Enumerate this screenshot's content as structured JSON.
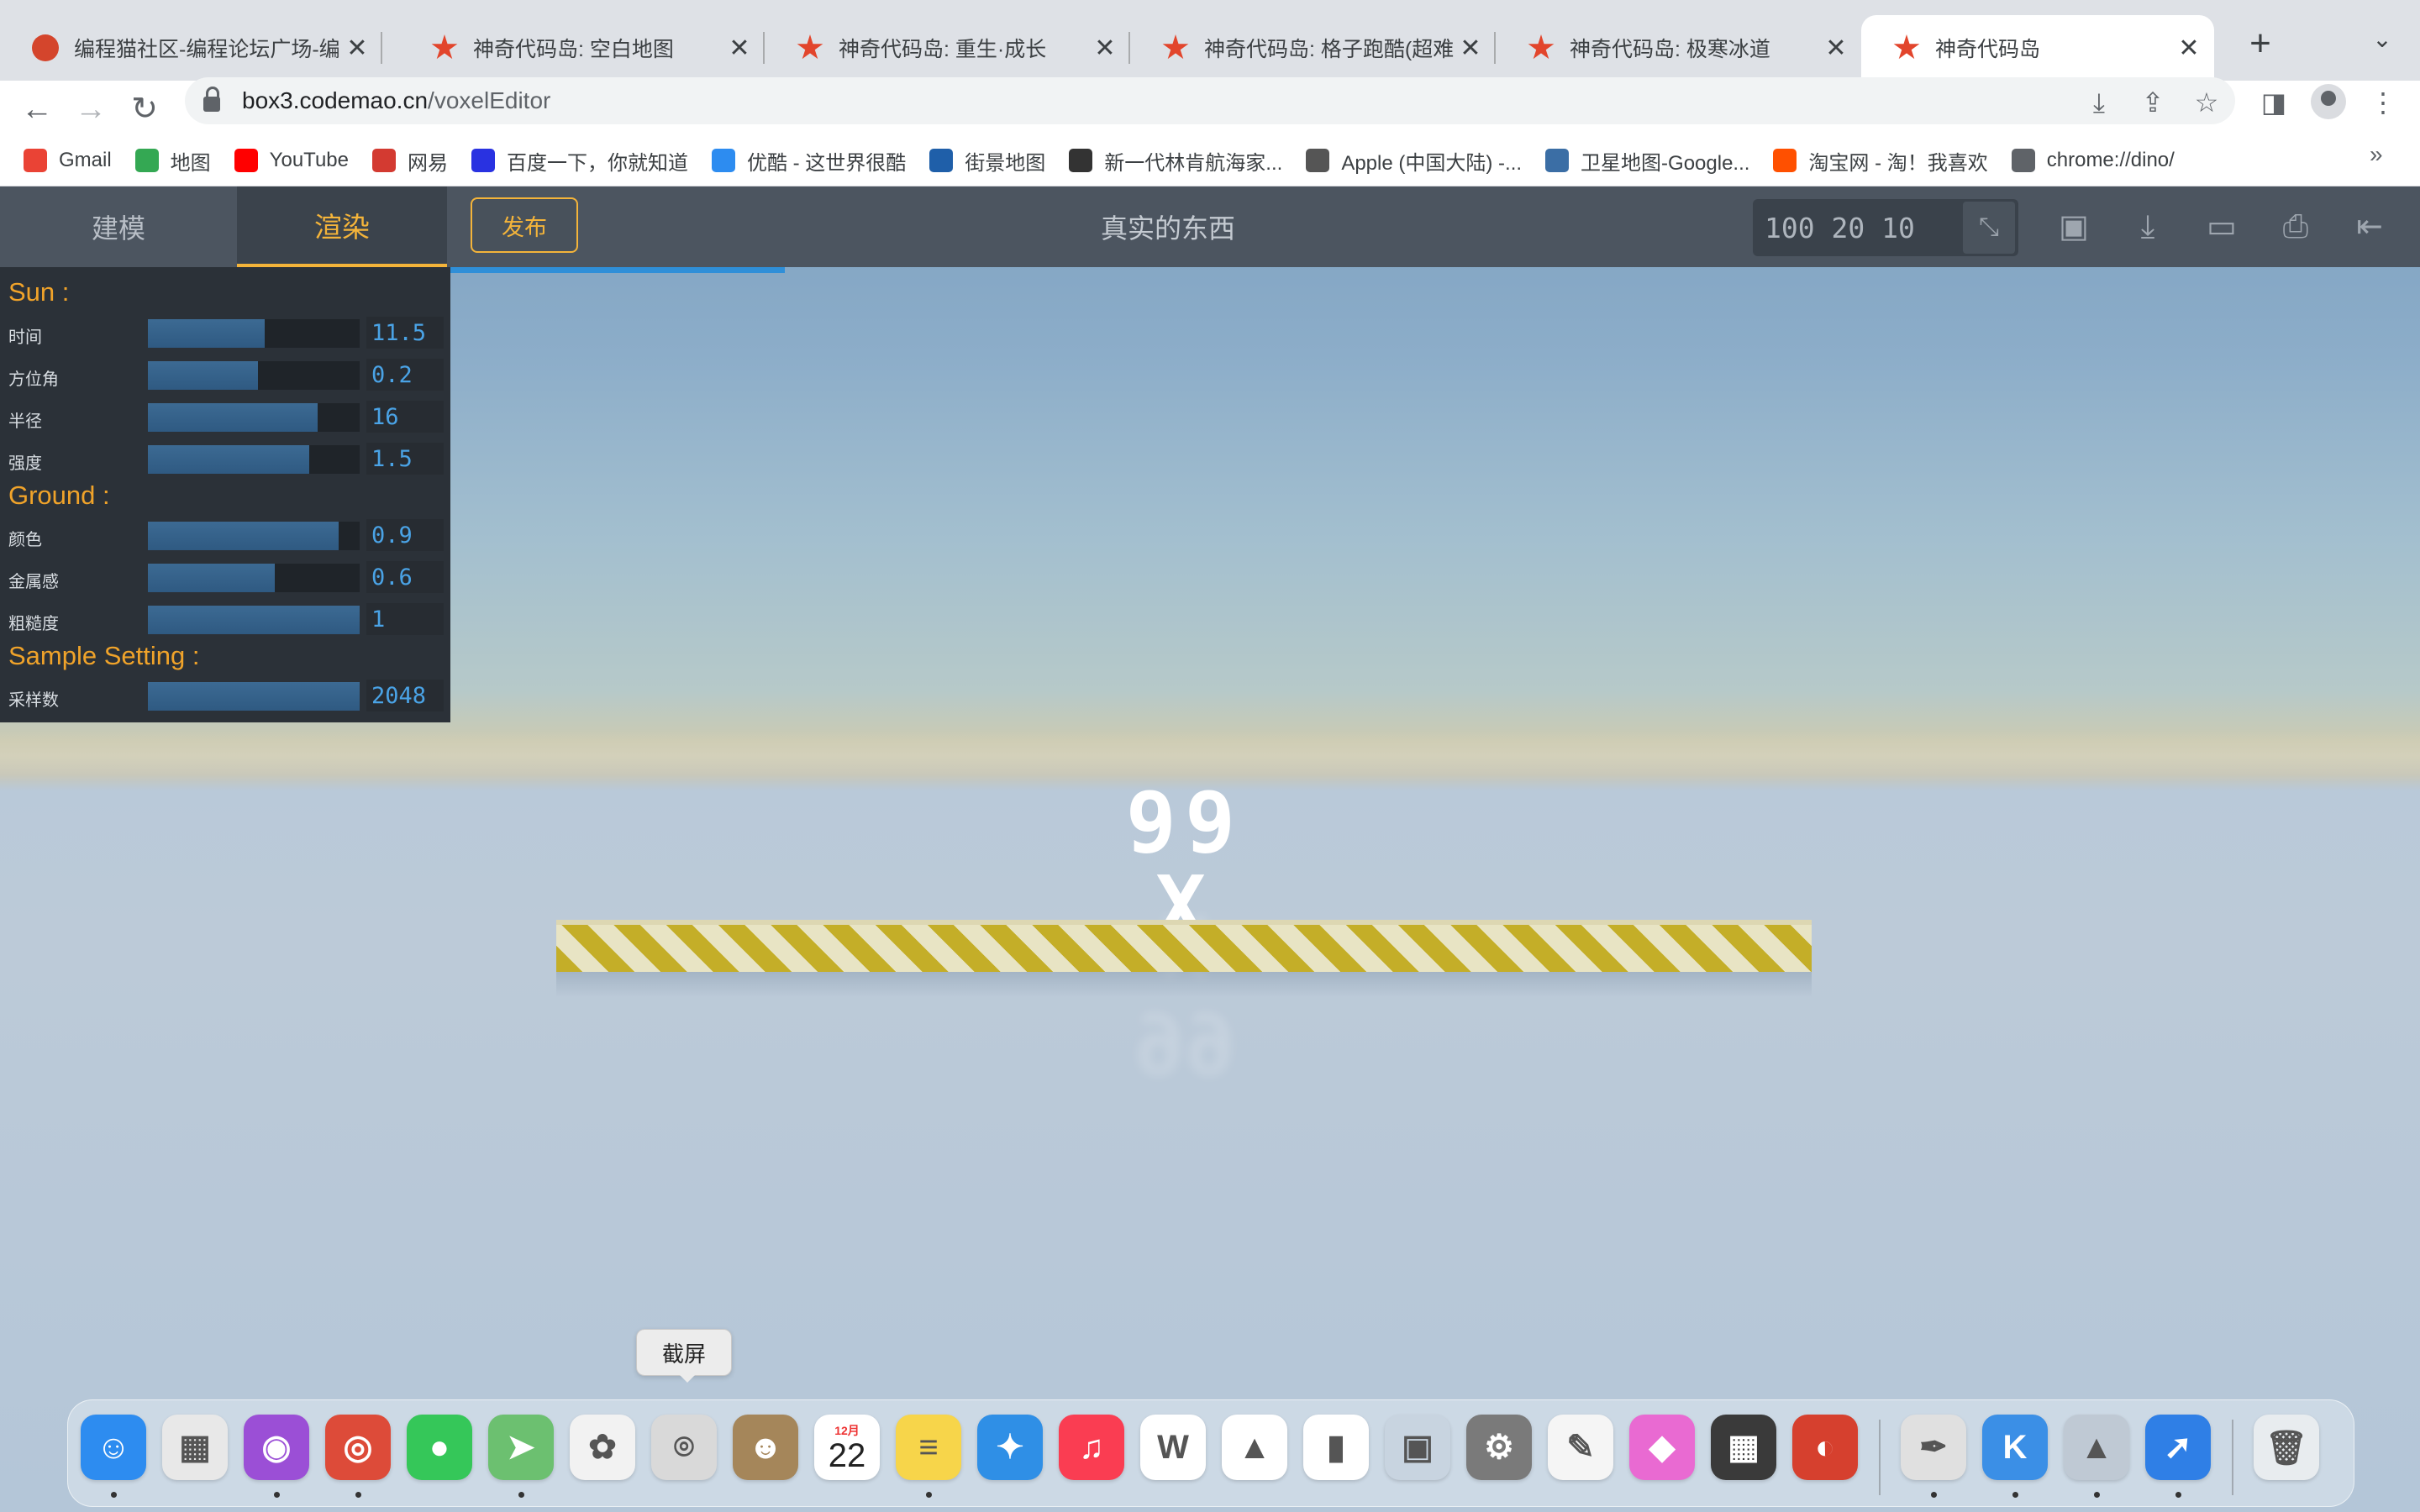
{
  "browser": {
    "tabs": [
      {
        "title": "编程猫社区-编程论坛广场-编"
      },
      {
        "title": "神奇代码岛: 空白地图"
      },
      {
        "title": "神奇代码岛: 重生·成长"
      },
      {
        "title": "神奇代码岛: 格子跑酷(超难!"
      },
      {
        "title": "神奇代码岛: 极寒冰道"
      },
      {
        "title": "神奇代码岛"
      }
    ],
    "close_glyph": "✕",
    "new_tab_glyph": "+",
    "tab_menu_glyph": "⌄",
    "url_host": "box3.codemao.cn",
    "url_path": "/voxelEditor",
    "bookmarks": [
      {
        "label": "Gmail",
        "icon": "gmail-icon",
        "color": "#ea4335"
      },
      {
        "label": "地图",
        "icon": "maps-icon",
        "color": "#34a853"
      },
      {
        "label": "YouTube",
        "icon": "youtube-icon",
        "color": "#ff0000"
      },
      {
        "label": "网易",
        "icon": "netease-icon",
        "color": "#d33a31"
      },
      {
        "label": "百度一下，你就知道",
        "icon": "baidu-icon",
        "color": "#2932e1"
      },
      {
        "label": "优酷 - 这世界很酷",
        "icon": "youku-icon",
        "color": "#2d8cf0"
      },
      {
        "label": "街景地图",
        "icon": "streetview-icon",
        "color": "#1f5fa9"
      },
      {
        "label": "新一代林肯航海家...",
        "icon": "lincoln-icon",
        "color": "#333333"
      },
      {
        "label": "Apple (中国大陆) -...",
        "icon": "apple-icon",
        "color": "#555555"
      },
      {
        "label": "卫星地图-Google...",
        "icon": "globe-icon",
        "color": "#3b6ea5"
      },
      {
        "label": "淘宝网 - 淘！我喜欢",
        "icon": "taobao-icon",
        "color": "#ff5000"
      },
      {
        "label": "chrome://dino/",
        "icon": "chrome-globe-icon",
        "color": "#5f6368"
      }
    ],
    "bookmarks_more": "»"
  },
  "editor": {
    "tab_model": "建模",
    "tab_render": "渲染",
    "publish": "发布",
    "title": "真实的东西",
    "size_value": "100 20 10",
    "size_btn_glyph": "⤡",
    "accent": "#f4b43a",
    "progress": 0.17
  },
  "panel": {
    "sun_title": "Sun :",
    "sun": [
      {
        "label": "时间",
        "value": "11.5",
        "fill": 0.55
      },
      {
        "label": "方位角",
        "value": "0.2",
        "fill": 0.52
      },
      {
        "label": "半径",
        "value": "16",
        "fill": 0.8
      },
      {
        "label": "强度",
        "value": "1.5",
        "fill": 0.76
      }
    ],
    "ground_title": "Ground :",
    "ground": [
      {
        "label": "颜色",
        "value": "0.9",
        "fill": 0.9
      },
      {
        "label": "金属感",
        "value": "0.6",
        "fill": 0.6
      },
      {
        "label": "粗糙度",
        "value": "1",
        "fill": 1.0
      }
    ],
    "sample_title": "Sample Setting :",
    "sample": [
      {
        "label": "采样数",
        "value": "2048",
        "fill": 1.0
      }
    ]
  },
  "scene": {
    "text": "99 X"
  },
  "dock": {
    "tooltip": "截屏",
    "apps": [
      {
        "name": "finder",
        "glyph": "☺",
        "color": "#2d8cf0",
        "running": true
      },
      {
        "name": "launchpad",
        "glyph": "▦",
        "color": "#e8e8e8",
        "running": false
      },
      {
        "name": "podcasts",
        "glyph": "◉",
        "color": "#9b4fd6",
        "running": true
      },
      {
        "name": "chrome",
        "glyph": "◎",
        "color": "#dd4b39",
        "running": true
      },
      {
        "name": "messages",
        "glyph": "●",
        "color": "#35c759",
        "running": false
      },
      {
        "name": "maps",
        "glyph": "➤",
        "color": "#6cc070",
        "running": true
      },
      {
        "name": "photos",
        "glyph": "✿",
        "color": "#f2f2f2",
        "running": false
      },
      {
        "name": "screenshot",
        "glyph": "⌾",
        "color": "#d9d9d9",
        "running": false
      },
      {
        "name": "contacts",
        "glyph": "☻",
        "color": "#a5865a",
        "running": false
      },
      {
        "name": "calendar",
        "glyph": "22",
        "color": "#ffffff",
        "running": false
      },
      {
        "name": "notes",
        "glyph": "≡",
        "color": "#f7d54a",
        "running": true
      },
      {
        "name": "safari",
        "glyph": "✦",
        "color": "#2f8fe6",
        "running": false
      },
      {
        "name": "music",
        "glyph": "♫",
        "color": "#fa3d52",
        "running": false
      },
      {
        "name": "wps",
        "glyph": "W",
        "color": "#ffffff",
        "running": false
      },
      {
        "name": "keynote",
        "glyph": "▲",
        "color": "#ffffff",
        "running": false
      },
      {
        "name": "numbers",
        "glyph": "▮",
        "color": "#ffffff",
        "running": false
      },
      {
        "name": "screen-sharing",
        "glyph": "▣",
        "color": "#c8d4e0",
        "running": false
      },
      {
        "name": "system-preferences",
        "glyph": "⚙",
        "color": "#7a7a7a",
        "running": false
      },
      {
        "name": "pages",
        "glyph": "✎",
        "color": "#f5f5f5",
        "running": false
      },
      {
        "name": "color-picker",
        "glyph": "◆",
        "color": "#e96ad2",
        "running": false
      },
      {
        "name": "calculator",
        "glyph": "▦",
        "color": "#3a3a3a",
        "running": false
      },
      {
        "name": "digital-color-meter",
        "glyph": "◐",
        "color": "#d6402e",
        "running": false
      },
      {
        "name": "script-editor",
        "glyph": "✒",
        "color": "#e0e0e0",
        "running": true
      },
      {
        "name": "kuaizip",
        "glyph": "K",
        "color": "#3b8fe6",
        "running": true
      },
      {
        "name": "rocket",
        "glyph": "▲",
        "color": "#bfc9d4",
        "running": true
      },
      {
        "name": "feishu",
        "glyph": "➚",
        "color": "#2f7fe6",
        "running": true
      },
      {
        "name": "trash",
        "glyph": "🗑",
        "color": "#e8ecef",
        "running": false
      }
    ],
    "calendar_month": "12月",
    "calendar_day": "22"
  }
}
